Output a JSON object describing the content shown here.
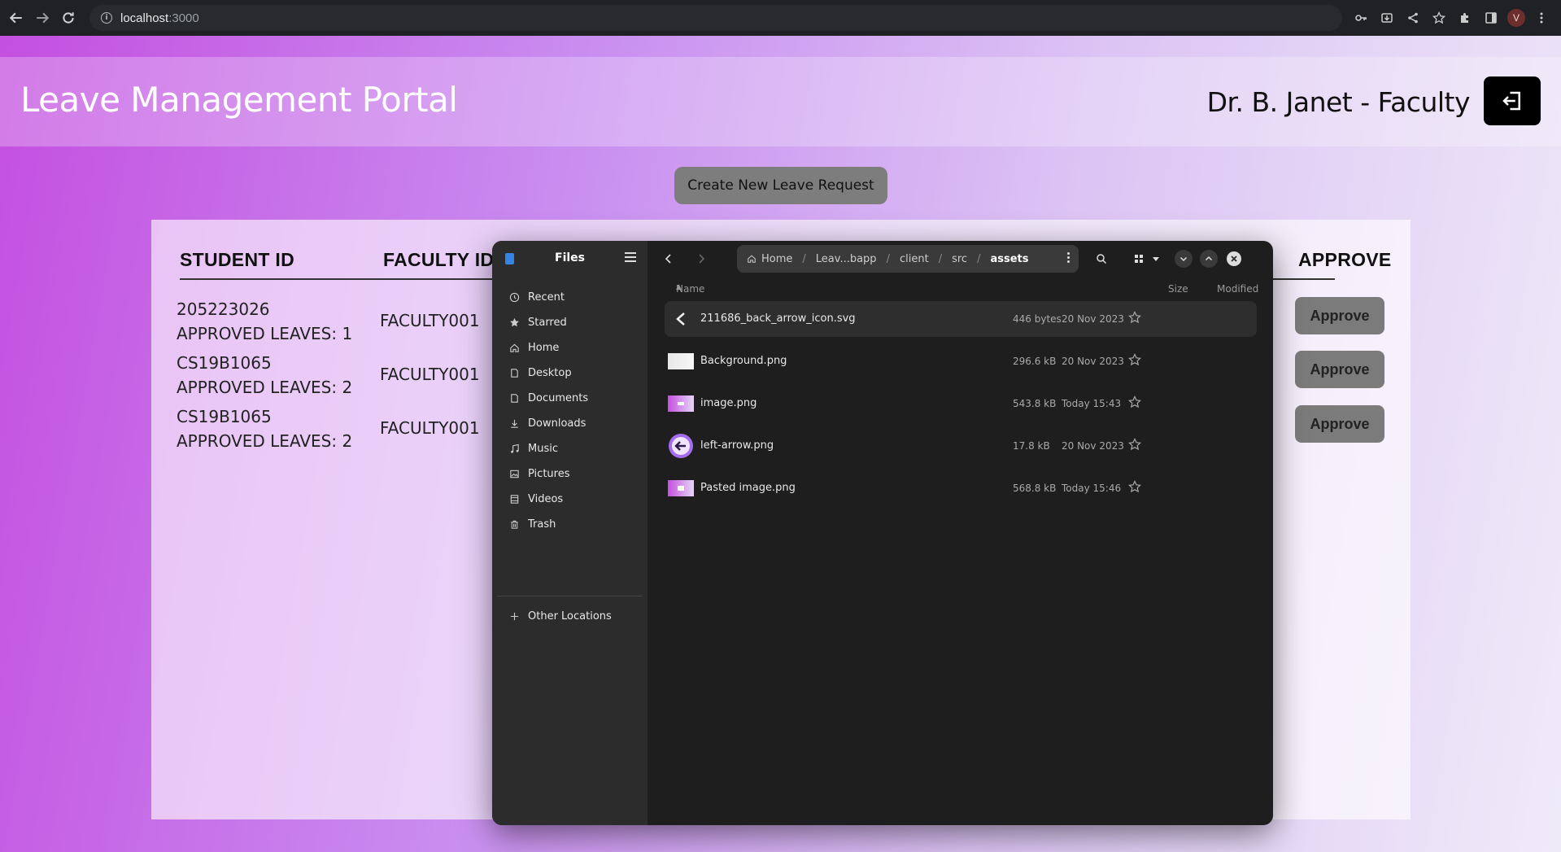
{
  "browser": {
    "url_host": "localhost",
    "url_port": ":3000",
    "profile_initial": "V"
  },
  "app": {
    "title": "Leave Management Portal",
    "user_label": "Dr. B. Janet - Faculty",
    "create_button": "Create New Leave Request"
  },
  "table": {
    "headers": {
      "student_id": "STUDENT ID",
      "faculty_id": "FACULTY ID",
      "approve": "APPROVE"
    },
    "rows": [
      {
        "student_id": "205223026",
        "approved_leaves": "APPROVED LEAVES: 1",
        "faculty_id": "FACULTY001",
        "action": "Approve"
      },
      {
        "student_id": "CS19B1065",
        "approved_leaves": "APPROVED LEAVES: 2",
        "faculty_id": "FACULTY001",
        "action": "Approve"
      },
      {
        "student_id": "CS19B1065",
        "approved_leaves": "APPROVED LEAVES: 2",
        "faculty_id": "FACULTY001",
        "action": "Approve"
      }
    ]
  },
  "files_window": {
    "title": "Files",
    "sidebar": [
      {
        "label": "Recent",
        "icon": "clock-icon"
      },
      {
        "label": "Starred",
        "icon": "star-icon"
      },
      {
        "label": "Home",
        "icon": "home-icon"
      },
      {
        "label": "Desktop",
        "icon": "desktop-icon"
      },
      {
        "label": "Documents",
        "icon": "documents-icon"
      },
      {
        "label": "Downloads",
        "icon": "downloads-icon"
      },
      {
        "label": "Music",
        "icon": "music-icon"
      },
      {
        "label": "Pictures",
        "icon": "pictures-icon"
      },
      {
        "label": "Videos",
        "icon": "videos-icon"
      },
      {
        "label": "Trash",
        "icon": "trash-icon"
      }
    ],
    "other_locations": "Other Locations",
    "path": {
      "home": "Home",
      "seg1": "Leav...bapp",
      "seg2": "client",
      "seg3": "src",
      "current": "assets",
      "separator": "/"
    },
    "columns": {
      "name": "Name",
      "size": "Size",
      "modified": "Modified"
    },
    "files": [
      {
        "name": "211686_back_arrow_icon.svg",
        "size": "446 bytes",
        "modified": "20 Nov 2023",
        "thumb": "back-arrow"
      },
      {
        "name": "Background.png",
        "size": "296.6 kB",
        "modified": "20 Nov 2023",
        "thumb": "background"
      },
      {
        "name": "image.png",
        "size": "543.8 kB",
        "modified": "Today 15:43",
        "thumb": "purple"
      },
      {
        "name": "left-arrow.png",
        "size": "17.8 kB",
        "modified": "20 Nov 2023",
        "thumb": "circle-arrow"
      },
      {
        "name": "Pasted image.png",
        "size": "568.8 kB",
        "modified": "Today 15:46",
        "thumb": "purple"
      }
    ]
  }
}
